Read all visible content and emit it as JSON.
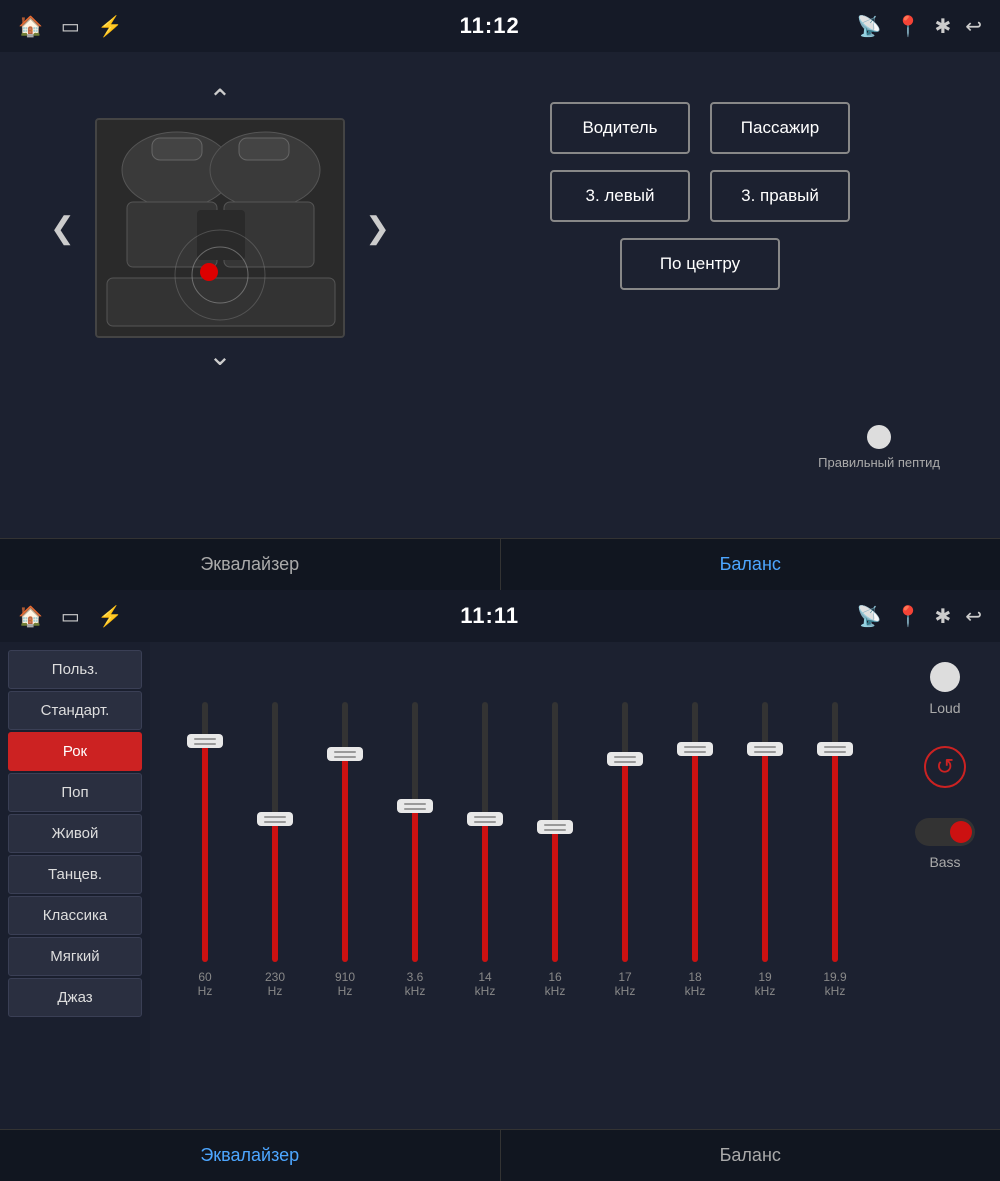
{
  "top": {
    "statusBar": {
      "time": "11:12",
      "leftIcons": [
        "home-icon",
        "screen-icon",
        "usb-icon"
      ],
      "rightIcons": [
        "cast-icon",
        "location-icon",
        "bluetooth-icon",
        "back-icon"
      ]
    },
    "zones": {
      "driver": "Водитель",
      "passenger": "Пассажир",
      "rearLeft": "3. левый",
      "rearRight": "3. правый",
      "center": "По центру"
    },
    "balanceLabel": "Правильный пептид",
    "tabs": {
      "equalizer": "Эквалайзер",
      "balance": "Баланс"
    }
  },
  "bottom": {
    "statusBar": {
      "time": "11:11"
    },
    "presets": [
      {
        "label": "Польз.",
        "active": false
      },
      {
        "label": "Стандарт.",
        "active": false
      },
      {
        "label": "Рок",
        "active": true
      },
      {
        "label": "Поп",
        "active": false
      },
      {
        "label": "Живой",
        "active": false
      },
      {
        "label": "Танцев.",
        "active": false
      },
      {
        "label": "Классика",
        "active": false
      },
      {
        "label": "Мягкий",
        "active": false
      },
      {
        "label": "Джаз",
        "active": false
      }
    ],
    "sliders": [
      {
        "freq": "60",
        "unit": "Hz",
        "fillPct": 85,
        "thumbPct": 85
      },
      {
        "freq": "230",
        "unit": "Hz",
        "fillPct": 55,
        "thumbPct": 55
      },
      {
        "freq": "910",
        "unit": "Hz",
        "fillPct": 80,
        "thumbPct": 80
      },
      {
        "freq": "3.6",
        "unit": "kHz",
        "fillPct": 60,
        "thumbPct": 60
      },
      {
        "freq": "14",
        "unit": "kHz",
        "fillPct": 55,
        "thumbPct": 55
      },
      {
        "freq": "16",
        "unit": "kHz",
        "fillPct": 52,
        "thumbPct": 52
      },
      {
        "freq": "17",
        "unit": "kHz",
        "fillPct": 78,
        "thumbPct": 78
      },
      {
        "freq": "18",
        "unit": "kHz",
        "fillPct": 82,
        "thumbPct": 82
      },
      {
        "freq": "19",
        "unit": "kHz",
        "fillPct": 82,
        "thumbPct": 82
      },
      {
        "freq": "19.9",
        "unit": "kHz",
        "fillPct": 82,
        "thumbPct": 82
      }
    ],
    "controls": {
      "loudLabel": "Loud",
      "resetTitle": "Reset",
      "bassLabel": "Bass"
    },
    "tabs": {
      "equalizer": "Эквалайзер",
      "balance": "Баланс"
    }
  }
}
